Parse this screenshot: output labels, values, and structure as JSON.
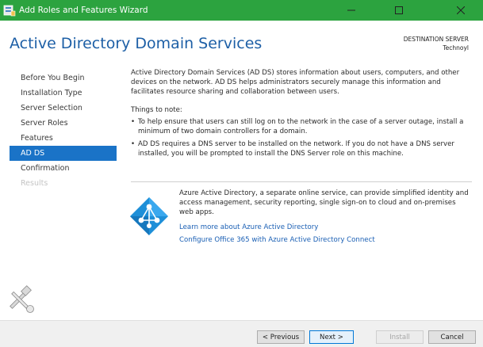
{
  "window": {
    "title": "Add Roles and Features Wizard",
    "titlebar_color": "#2ca33f",
    "icons": {
      "app": "server-manager-icon",
      "minimize": "minimize-icon",
      "maximize": "maximize-icon",
      "close": "close-icon"
    }
  },
  "header": {
    "title": "Active Directory Domain Services",
    "destination_label": "DESTINATION SERVER",
    "destination_value": "Technoyl"
  },
  "nav": {
    "items": [
      {
        "label": "Before You Begin",
        "state": "normal"
      },
      {
        "label": "Installation Type",
        "state": "normal"
      },
      {
        "label": "Server Selection",
        "state": "normal"
      },
      {
        "label": "Server Roles",
        "state": "normal"
      },
      {
        "label": "Features",
        "state": "normal"
      },
      {
        "label": "AD DS",
        "state": "active"
      },
      {
        "label": "Confirmation",
        "state": "normal"
      },
      {
        "label": "Results",
        "state": "disabled"
      }
    ],
    "active_color": "#1a73c7"
  },
  "content": {
    "intro": "Active Directory Domain Services (AD DS) stores information about users, computers, and other devices on the network.  AD DS helps administrators securely manage this information and facilitates resource sharing and collaboration between users.",
    "things_heading": "Things to note:",
    "bullets": [
      "To help ensure that users can still log on to the network in the case of a server outage, install a minimum of two domain controllers for a domain.",
      "AD DS requires a DNS server to be installed on the network.  If you do not have a DNS server installed, you will be prompted to install the DNS Server role on this machine."
    ]
  },
  "azure": {
    "logo": "azure-active-directory-icon",
    "description": "Azure Active Directory, a separate online service, can provide simplified identity and access management, security reporting, single sign-on to cloud and on-premises web apps.",
    "link_learn": "Learn more about Azure Active Directory",
    "link_configure": "Configure Office 365 with Azure Active Directory Connect",
    "link_color": "#1a5fb4"
  },
  "footer": {
    "previous": "< Previous",
    "next": "Next >",
    "install": "Install",
    "cancel": "Cancel"
  },
  "watermark": {
    "icon": "wrench-hammer-icon"
  }
}
